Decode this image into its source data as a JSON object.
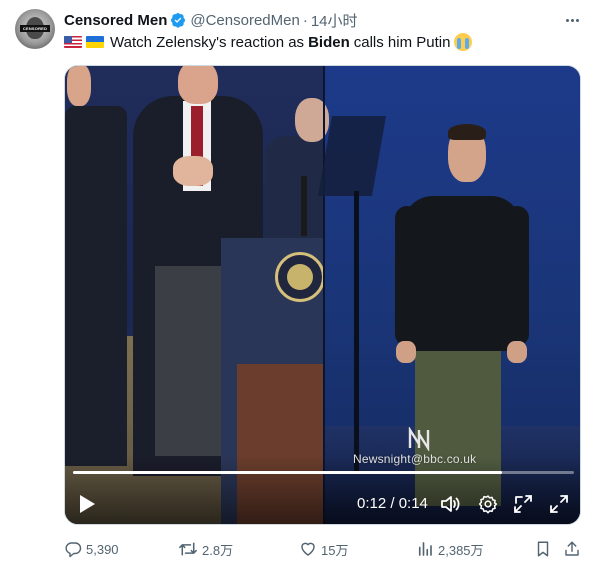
{
  "tweet": {
    "display_name": "Censored Men",
    "handle": "@CensoredMen",
    "separator": "·",
    "timestamp": "14小时",
    "verified": true,
    "avatar": {
      "label": "CENSORED"
    },
    "text": {
      "flags": [
        "us-flag",
        "ukraine-flag"
      ],
      "before": "Watch Zelensky's reaction as",
      "bold": "Biden",
      "after": "calls him Putin",
      "emoji": "loudly-crying-face"
    }
  },
  "video": {
    "watermark": "Newsnight@bbc.co.uk",
    "current_time": "0:12",
    "duration": "0:14",
    "time_display": "0:12 / 0:14",
    "progress": 0.857,
    "controls": [
      "play-icon",
      "volume-icon",
      "settings-gear-icon",
      "minimize-icon",
      "fullscreen-icon"
    ]
  },
  "actions": {
    "replies": "5,390",
    "retweets": "2.8万",
    "likes": "15万",
    "views": "2,385万"
  },
  "colors": {
    "text_primary": "#0f1419",
    "text_secondary": "#536471",
    "verified_blue": "#1d9bf0"
  }
}
